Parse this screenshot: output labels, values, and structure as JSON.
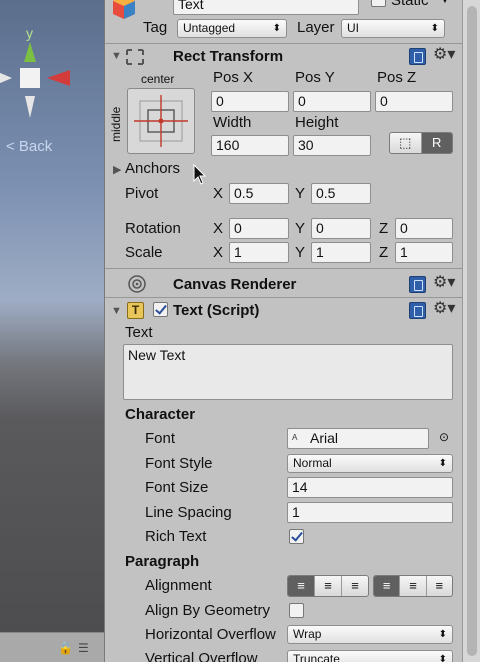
{
  "header": {
    "object_name": "Text",
    "static_label": "Static",
    "tag_label": "Tag",
    "tag_value": "Untagged",
    "layer_label": "Layer",
    "layer_value": "UI"
  },
  "scene": {
    "gizmo_axis_label": "y",
    "back_label": "< Back"
  },
  "rect_transform": {
    "title": "Rect Transform",
    "anchor_h_label": "center",
    "anchor_v_label": "middle",
    "pos_x_label": "Pos X",
    "pos_y_label": "Pos Y",
    "pos_z_label": "Pos Z",
    "pos_x": "0",
    "pos_y": "0",
    "pos_z": "0",
    "width_label": "Width",
    "height_label": "Height",
    "width": "160",
    "height": "30",
    "raw_edit_label": "R",
    "anchors_label": "Anchors",
    "pivot_label": "Pivot",
    "pivot_x_label": "X",
    "pivot_x": "0.5",
    "pivot_y_label": "Y",
    "pivot_y": "0.5",
    "rotation_label": "Rotation",
    "rot_x_label": "X",
    "rot_x": "0",
    "rot_y_label": "Y",
    "rot_y": "0",
    "rot_z_label": "Z",
    "rot_z": "0",
    "scale_label": "Scale",
    "scale_x_label": "X",
    "scale_x": "1",
    "scale_y_label": "Y",
    "scale_y": "1",
    "scale_z_label": "Z",
    "scale_z": "1"
  },
  "canvas_renderer": {
    "title": "Canvas Renderer"
  },
  "text_script": {
    "title": "Text (Script)",
    "text_label": "Text",
    "text_value": "New Text",
    "character_label": "Character",
    "font_label": "Font",
    "font_value": "Arial",
    "font_style_label": "Font Style",
    "font_style_value": "Normal",
    "font_size_label": "Font Size",
    "font_size_value": "14",
    "line_spacing_label": "Line Spacing",
    "line_spacing_value": "1",
    "rich_text_label": "Rich Text",
    "paragraph_label": "Paragraph",
    "alignment_label": "Alignment",
    "align_by_geometry_label": "Align By Geometry",
    "h_overflow_label": "Horizontal Overflow",
    "h_overflow_value": "Wrap",
    "v_overflow_label": "Vertical Overflow",
    "v_overflow_value": "Truncate"
  },
  "colors": {
    "inspector_bg": "#c2c2c2",
    "accent_blue": "#2f5fa8",
    "anchor_red": "#c0392b",
    "gizmo_red": "#d43b3b",
    "gizmo_green": "#7bc043"
  }
}
